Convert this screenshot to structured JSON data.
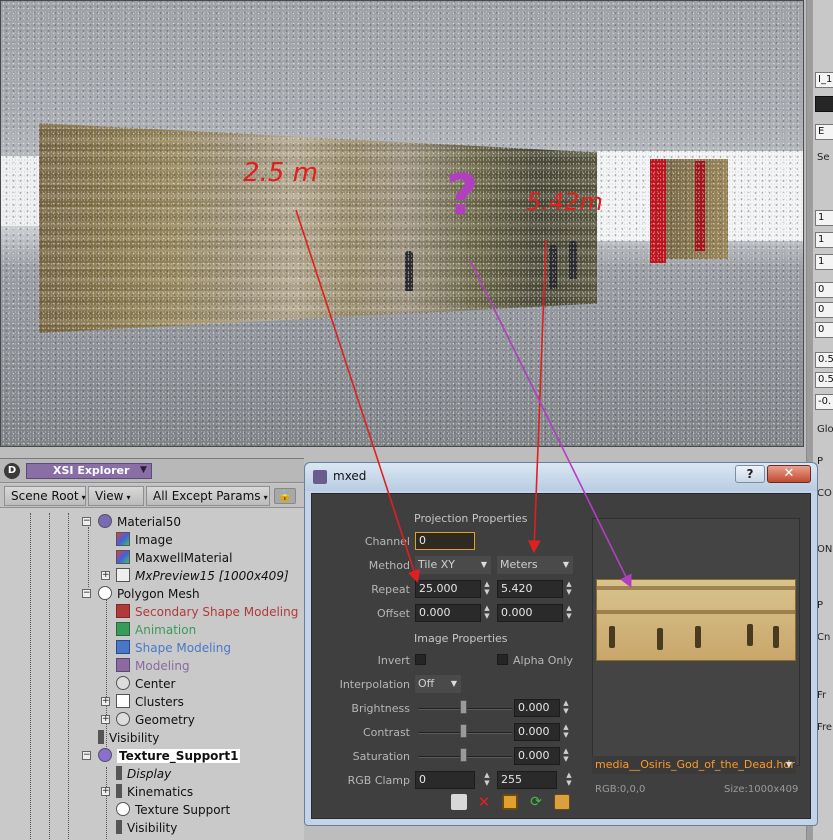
{
  "viewport": {
    "annotations": {
      "left_width": "2.5 m",
      "question": "?",
      "right_width": "5.42m"
    },
    "colors": {
      "annotation_red": "#e02020",
      "annotation_purple": "#b040c0"
    }
  },
  "right_panel": {
    "items": [
      "I_1",
      "",
      "E",
      "Se",
      "1",
      "1",
      "1",
      "0",
      "0",
      "0",
      "0.5",
      "0.5",
      "-0.",
      "Glo",
      "P",
      "CO",
      "ON",
      "P",
      "Cn",
      "Fr",
      "Fre"
    ]
  },
  "explorer": {
    "logo": "D",
    "title": "XSI Explorer",
    "toolbar": {
      "scene_root": "Scene Root",
      "view": "View",
      "filter": "All Except Params"
    },
    "tree": [
      {
        "label": "Material50"
      },
      {
        "label": "Image"
      },
      {
        "label": "MaxwellMaterial"
      },
      {
        "label": "MxPreview15 [1000x409]"
      },
      {
        "label": "Polygon Mesh"
      },
      {
        "label": "Secondary Shape Modeling"
      },
      {
        "label": "Animation"
      },
      {
        "label": "Shape Modeling"
      },
      {
        "label": "Modeling"
      },
      {
        "label": "Center"
      },
      {
        "label": "Clusters"
      },
      {
        "label": "Geometry"
      },
      {
        "label": "Visibility"
      },
      {
        "label": "Texture_Support1"
      },
      {
        "label": "Display"
      },
      {
        "label": "Kinematics"
      },
      {
        "label": "Texture Support"
      },
      {
        "label": "Visibility"
      }
    ]
  },
  "dialog": {
    "title": "mxed",
    "help": "?",
    "close": "✕",
    "projection_header": "Projection Properties",
    "channel_label": "Channel",
    "channel_value": "0",
    "method_label": "Method",
    "method_value": "Tile XY",
    "units_value": "Meters",
    "repeat_label": "Repeat",
    "repeat_x": "25.000",
    "repeat_y": "5.420",
    "offset_label": "Offset",
    "offset_x": "0.000",
    "offset_y": "0.000",
    "image_header": "Image Properties",
    "invert_label": "Invert",
    "alpha_label": "Alpha Only",
    "interp_label": "Interpolation",
    "interp_value": "Off",
    "brightness_label": "Brightness",
    "brightness_value": "0.000",
    "contrast_label": "Contrast",
    "contrast_value": "0.000",
    "saturation_label": "Saturation",
    "saturation_value": "0.000",
    "clamp_label": "RGB Clamp",
    "clamp_min": "0",
    "clamp_max": "255",
    "file_name": "media__Osiris_God_of_the_Dead.hdr",
    "rgb_info": "RGB:0,0,0",
    "size_info": "Size:1000x409",
    "colors": {
      "body_bg": "#3f3f3f",
      "file_text": "#ff9a2a",
      "channel_border": "#e0a030"
    }
  }
}
